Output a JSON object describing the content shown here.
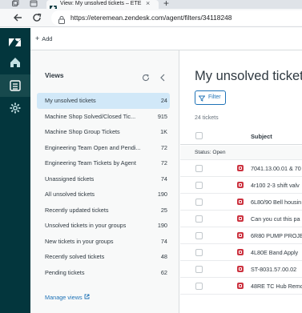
{
  "browser": {
    "tab_title": "View: My unsolved tickets – ETE",
    "url": "https://eteremean.zendesk.com/agent/filters/34118248"
  },
  "colors": {
    "rail": "#03363d",
    "accent": "#1f73b7",
    "active_view": "#d1e8f8",
    "status_open": "#cc3340"
  },
  "appbar": {
    "add_label": "Add"
  },
  "views": {
    "header": "Views",
    "items": [
      {
        "label": "My unsolved tickets",
        "count": "24",
        "active": true
      },
      {
        "label": "Machine Shop Solved/Closed Tic...",
        "count": "915"
      },
      {
        "label": "Machine Shop Group Tickets",
        "count": "1K"
      },
      {
        "label": "Engineering Team Open and Pendi...",
        "count": "72"
      },
      {
        "label": "Engineering Team Tickets by Agent",
        "count": "72"
      },
      {
        "label": "Unassigned tickets",
        "count": "74"
      },
      {
        "label": "All unsolved tickets",
        "count": "190"
      },
      {
        "label": "Recently updated tickets",
        "count": "25"
      },
      {
        "label": "Unsolved tickets in your groups",
        "count": "190"
      },
      {
        "label": "New tickets in your groups",
        "count": "74"
      },
      {
        "label": "Recently solved tickets",
        "count": "48"
      },
      {
        "label": "Pending tickets",
        "count": "62"
      }
    ],
    "manage_label": "Manage views"
  },
  "main": {
    "title": "My unsolved tickets",
    "filter_label": "Filter",
    "ticket_count": "24 tickets",
    "subject_header": "Subject",
    "group_label": "Status: Open",
    "tickets": [
      "7041.13.00.01 & 70",
      "4r100 2-3 shift valv",
      "6L80/90 Bell housin",
      "Can you cut this pa",
      "6R80 PUMP PROJE",
      "4L80E Band Apply",
      "ST-8031.57.00.02",
      "48RE TC Hub Remo"
    ]
  }
}
